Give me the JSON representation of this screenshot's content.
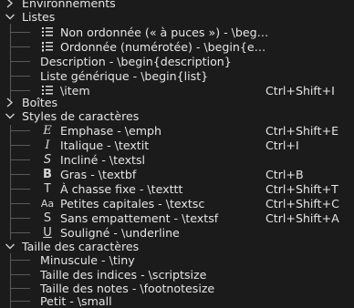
{
  "tree": {
    "cat_environnements": "Environnements",
    "cat_listes": "Listes",
    "listes_items": [
      {
        "icon": "bullet-list-icon",
        "label": "Non ordonnée (« à puces ») - \\beg…",
        "shortcut": ""
      },
      {
        "icon": "numbered-list-icon",
        "label": "Ordonnée (numérotée) - \\begin{e…",
        "shortcut": ""
      },
      {
        "icon": "",
        "label": "Description - \\begin{description}",
        "shortcut": ""
      },
      {
        "icon": "",
        "label": "Liste générique - \\begin{list}",
        "shortcut": ""
      },
      {
        "icon": "item-list-icon",
        "label": "\\item",
        "shortcut": "Ctrl+Shift+I"
      }
    ],
    "cat_boites": "Boîtes",
    "cat_styles": "Styles de caractères",
    "styles_items": [
      {
        "icon": "emphasis-icon",
        "glyph": "E",
        "label": "Emphase - \\emph",
        "shortcut": "Ctrl+Shift+E"
      },
      {
        "icon": "italic-icon",
        "glyph": "I",
        "label": "Italique - \\textit",
        "shortcut": "Ctrl+I"
      },
      {
        "icon": "slanted-icon",
        "glyph": "S",
        "label": "Incliné - \\textsl",
        "shortcut": ""
      },
      {
        "icon": "bold-icon",
        "glyph": "B",
        "label": "Gras - \\textbf",
        "shortcut": "Ctrl+B"
      },
      {
        "icon": "typewriter-icon",
        "glyph": "T",
        "label": "À chasse fixe - \\texttt",
        "shortcut": "Ctrl+Shift+T"
      },
      {
        "icon": "small-caps-icon",
        "glyph": "Aa",
        "label": "Petites capitales - \\textsc",
        "shortcut": "Ctrl+Shift+C"
      },
      {
        "icon": "sans-serif-icon",
        "glyph": "S",
        "label": "Sans empattement - \\textsf",
        "shortcut": "Ctrl+Shift+A"
      },
      {
        "icon": "underline-icon",
        "glyph": "U",
        "label": "Souligné - \\underline",
        "shortcut": ""
      }
    ],
    "cat_taille": "Taille des caractères",
    "taille_items": [
      {
        "label": "Minuscule - \\tiny"
      },
      {
        "label": "Taille des indices - \\scriptsize"
      },
      {
        "label": "Taille des notes - \\footnotesize"
      },
      {
        "label": "Petit - \\small"
      }
    ]
  }
}
